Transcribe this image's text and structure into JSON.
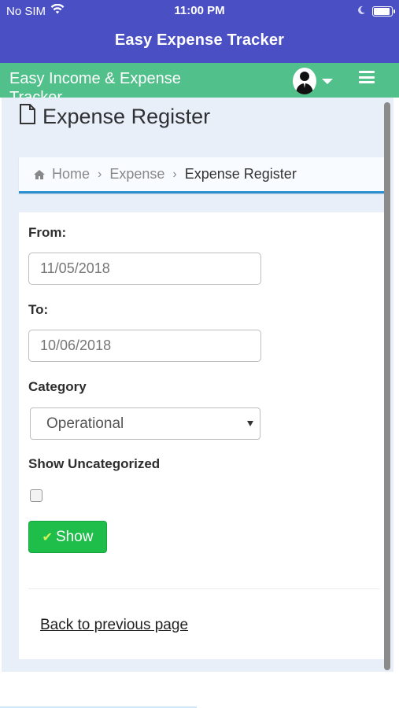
{
  "status_bar": {
    "carrier": "No SIM",
    "time": "11:00 PM"
  },
  "nav": {
    "title": "Easy Expense Tracker"
  },
  "app_header": {
    "brand": "Easy Income & Expense Tracker",
    "menu_icon": "hamburger-icon",
    "profile_icon": "user-avatar-icon"
  },
  "page": {
    "title": "Expense Register",
    "title_icon": "document-icon"
  },
  "breadcrumb": {
    "items": [
      "Home",
      "Expense",
      "Expense Register"
    ]
  },
  "form": {
    "from_label": "From:",
    "from_value": "11/05/2018",
    "to_label": "To:",
    "to_value": "10/06/2018",
    "category_label": "Category",
    "category_value": "Operational",
    "uncategorized_label": "Show Uncategorized",
    "uncategorized_checked": false,
    "show_button": "Show",
    "back_link": "Back to previous page"
  },
  "colors": {
    "nav_bg": "#4b4fc4",
    "header_bg": "#52c08a",
    "button_bg": "#1fbe4a",
    "breadcrumb_border": "#2b8fcf"
  }
}
